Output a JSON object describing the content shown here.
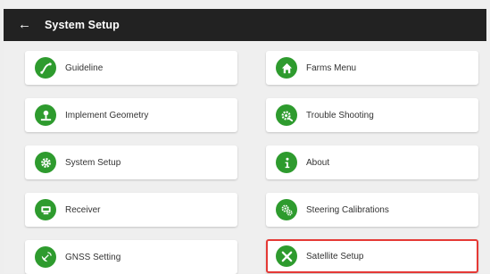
{
  "header": {
    "back_icon": "arrow-left-icon",
    "title": "System Setup"
  },
  "accent_color": "#2e9b2e",
  "selection_color": "#e53935",
  "menu": {
    "left": [
      {
        "label": "Guideline",
        "icon": "guideline-icon"
      },
      {
        "label": "Implement Geometry",
        "icon": "implement-icon"
      },
      {
        "label": "System Setup",
        "icon": "gear-icon"
      },
      {
        "label": "Receiver",
        "icon": "receiver-icon"
      },
      {
        "label": "GNSS Setting",
        "icon": "satellite-dish-icon"
      }
    ],
    "right": [
      {
        "label": "Farms Menu",
        "icon": "home-icon"
      },
      {
        "label": "Trouble Shooting",
        "icon": "gear-wrench-icon"
      },
      {
        "label": "About",
        "icon": "info-icon"
      },
      {
        "label": "Steering Calibrations",
        "icon": "gears-icon"
      },
      {
        "label": "Satellite Setup",
        "icon": "satellite-tools-icon",
        "selected": true
      }
    ]
  }
}
